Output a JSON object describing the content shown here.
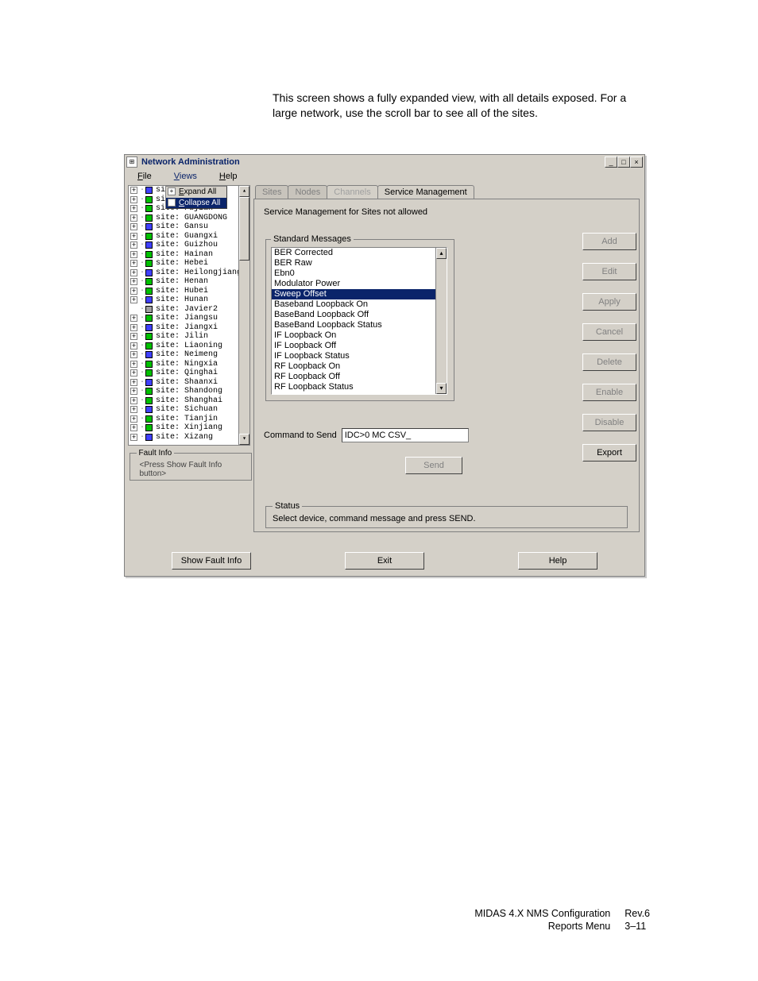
{
  "intro": "This screen shows a fully expanded view, with all details exposed. For a large network, use the scroll bar to see all of the sites.",
  "window": {
    "title": "Network Administration",
    "menus": {
      "file": "File",
      "views": "Views",
      "help": "Help"
    },
    "win_controls": {
      "min": "_",
      "max": "□",
      "close": "×"
    }
  },
  "context_menu": {
    "expand": "Expand All",
    "collapse": "Collapse All"
  },
  "tree": [
    {
      "label": "si",
      "status": "blue"
    },
    {
      "label": "si",
      "status": "green"
    },
    {
      "label": "site: Fujian",
      "status": "green"
    },
    {
      "label": "site: GUANGDONG",
      "status": "green"
    },
    {
      "label": "site: Gansu",
      "status": "blue"
    },
    {
      "label": "site: Guangxi",
      "status": "green"
    },
    {
      "label": "site: Guizhou",
      "status": "blue"
    },
    {
      "label": "site: Hainan",
      "status": "green"
    },
    {
      "label": "site: Hebei",
      "status": "green"
    },
    {
      "label": "site: Heilongjiang",
      "status": "blue"
    },
    {
      "label": "site: Henan",
      "status": "green"
    },
    {
      "label": "site: Hubei",
      "status": "green"
    },
    {
      "label": "site: Hunan",
      "status": "blue"
    },
    {
      "label": "site: Javier2",
      "status": "gray",
      "leaf": true
    },
    {
      "label": "site: Jiangsu",
      "status": "green"
    },
    {
      "label": "site: Jiangxi",
      "status": "blue"
    },
    {
      "label": "site: Jilin",
      "status": "green"
    },
    {
      "label": "site: Liaoning",
      "status": "green"
    },
    {
      "label": "site: Neimeng",
      "status": "blue"
    },
    {
      "label": "site: Ningxia",
      "status": "green"
    },
    {
      "label": "site: Qinghai",
      "status": "green"
    },
    {
      "label": "site: Shaanxi",
      "status": "blue"
    },
    {
      "label": "site: Shandong",
      "status": "green"
    },
    {
      "label": "site: Shanghai",
      "status": "green"
    },
    {
      "label": "site: Sichuan",
      "status": "blue"
    },
    {
      "label": "site: Tianjin",
      "status": "green"
    },
    {
      "label": "site: Xinjiang",
      "status": "green"
    },
    {
      "label": "site: Xizang",
      "status": "blue"
    }
  ],
  "fault_info": {
    "legend": "Fault Info",
    "text": "<Press Show Fault Info button>"
  },
  "tabs": {
    "sites": "Sites",
    "nodes": "Nodes",
    "channels": "Channels",
    "service": "Service Management"
  },
  "service_heading": "Service Management for Sites not allowed",
  "std_legend": "Standard Messages",
  "messages": [
    "BER Corrected",
    "BER Raw",
    "Ebn0",
    "Modulator Power",
    "Sweep Offset",
    "Baseband Loopback On",
    "BaseBand Loopback Off",
    "BaseBand Loopback Status",
    "IF Loopback On",
    "IF Loopback Off",
    "IF Loopback Status",
    "RF Loopback On",
    "RF Loopback Off",
    "RF Loopback Status"
  ],
  "selected_message_index": 4,
  "command_label": "Command to Send",
  "command_value": "IDC>0 MC CSV_",
  "send_label": "Send",
  "status": {
    "legend": "Status",
    "text": "Select device, command message and press SEND."
  },
  "side_buttons": {
    "add": "Add",
    "edit": "Edit",
    "apply": "Apply",
    "cancel": "Cancel",
    "delete": "Delete",
    "enable": "Enable",
    "disable": "Disable",
    "export": "Export"
  },
  "bottom_buttons": {
    "show_fault": "Show Fault Info",
    "exit": "Exit",
    "help": "Help"
  },
  "footer": {
    "line1a": "MIDAS 4.X  NMS Configuration",
    "line1b": "Rev.6",
    "line2a": "Reports Menu",
    "line2b": "3–11"
  }
}
